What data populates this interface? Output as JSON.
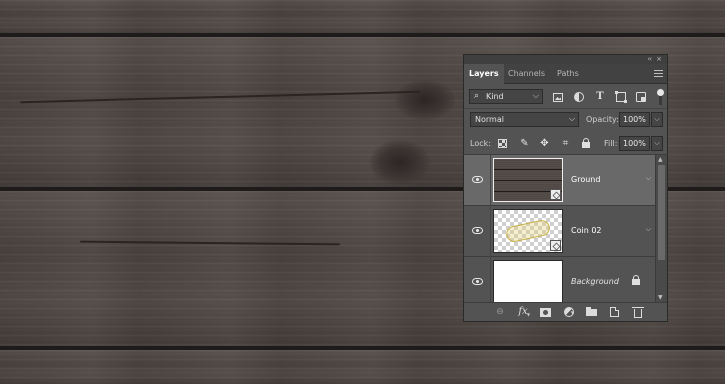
{
  "panel": {
    "tabs": [
      {
        "label": "Layers",
        "active": true
      },
      {
        "label": "Channels",
        "active": false
      },
      {
        "label": "Paths",
        "active": false
      }
    ],
    "filter": {
      "kind_label": "Kind",
      "icons": [
        "pixel-filter-icon",
        "adjustment-filter-icon",
        "type-filter-icon",
        "shape-filter-icon",
        "smart-object-filter-icon"
      ]
    },
    "blend_mode": "Normal",
    "opacity_label": "Opacity:",
    "opacity_value": "100%",
    "lock_label": "Lock:",
    "lock_icons": [
      "lock-transparent-icon",
      "lock-paint-icon",
      "lock-position-icon",
      "lock-artboard-icon",
      "lock-all-icon"
    ],
    "fill_label": "Fill:",
    "fill_value": "100%",
    "layers": [
      {
        "name": "Ground",
        "visible": true,
        "selected": true,
        "smart_object": true,
        "locked": false
      },
      {
        "name": "Coin 02",
        "visible": true,
        "selected": false,
        "smart_object": true,
        "locked": false
      },
      {
        "name": "Background",
        "visible": true,
        "selected": false,
        "smart_object": false,
        "locked": true
      }
    ],
    "bottom_icons": [
      "link-layers-icon",
      "fx-icon",
      "add-mask-icon",
      "adjustment-layer-icon",
      "new-group-icon",
      "new-layer-icon",
      "delete-icon"
    ]
  },
  "glyphs": {
    "collapse": "‹‹",
    "close": "×",
    "search": "⌕",
    "dropdown": "⌵",
    "arrow": "›",
    "scroll_up": "▲",
    "scroll_down": "▼",
    "paint": "✎",
    "move": "✥",
    "artboard": "⌗",
    "lock": "🔒",
    "link": "⊖",
    "fx": "fx"
  }
}
